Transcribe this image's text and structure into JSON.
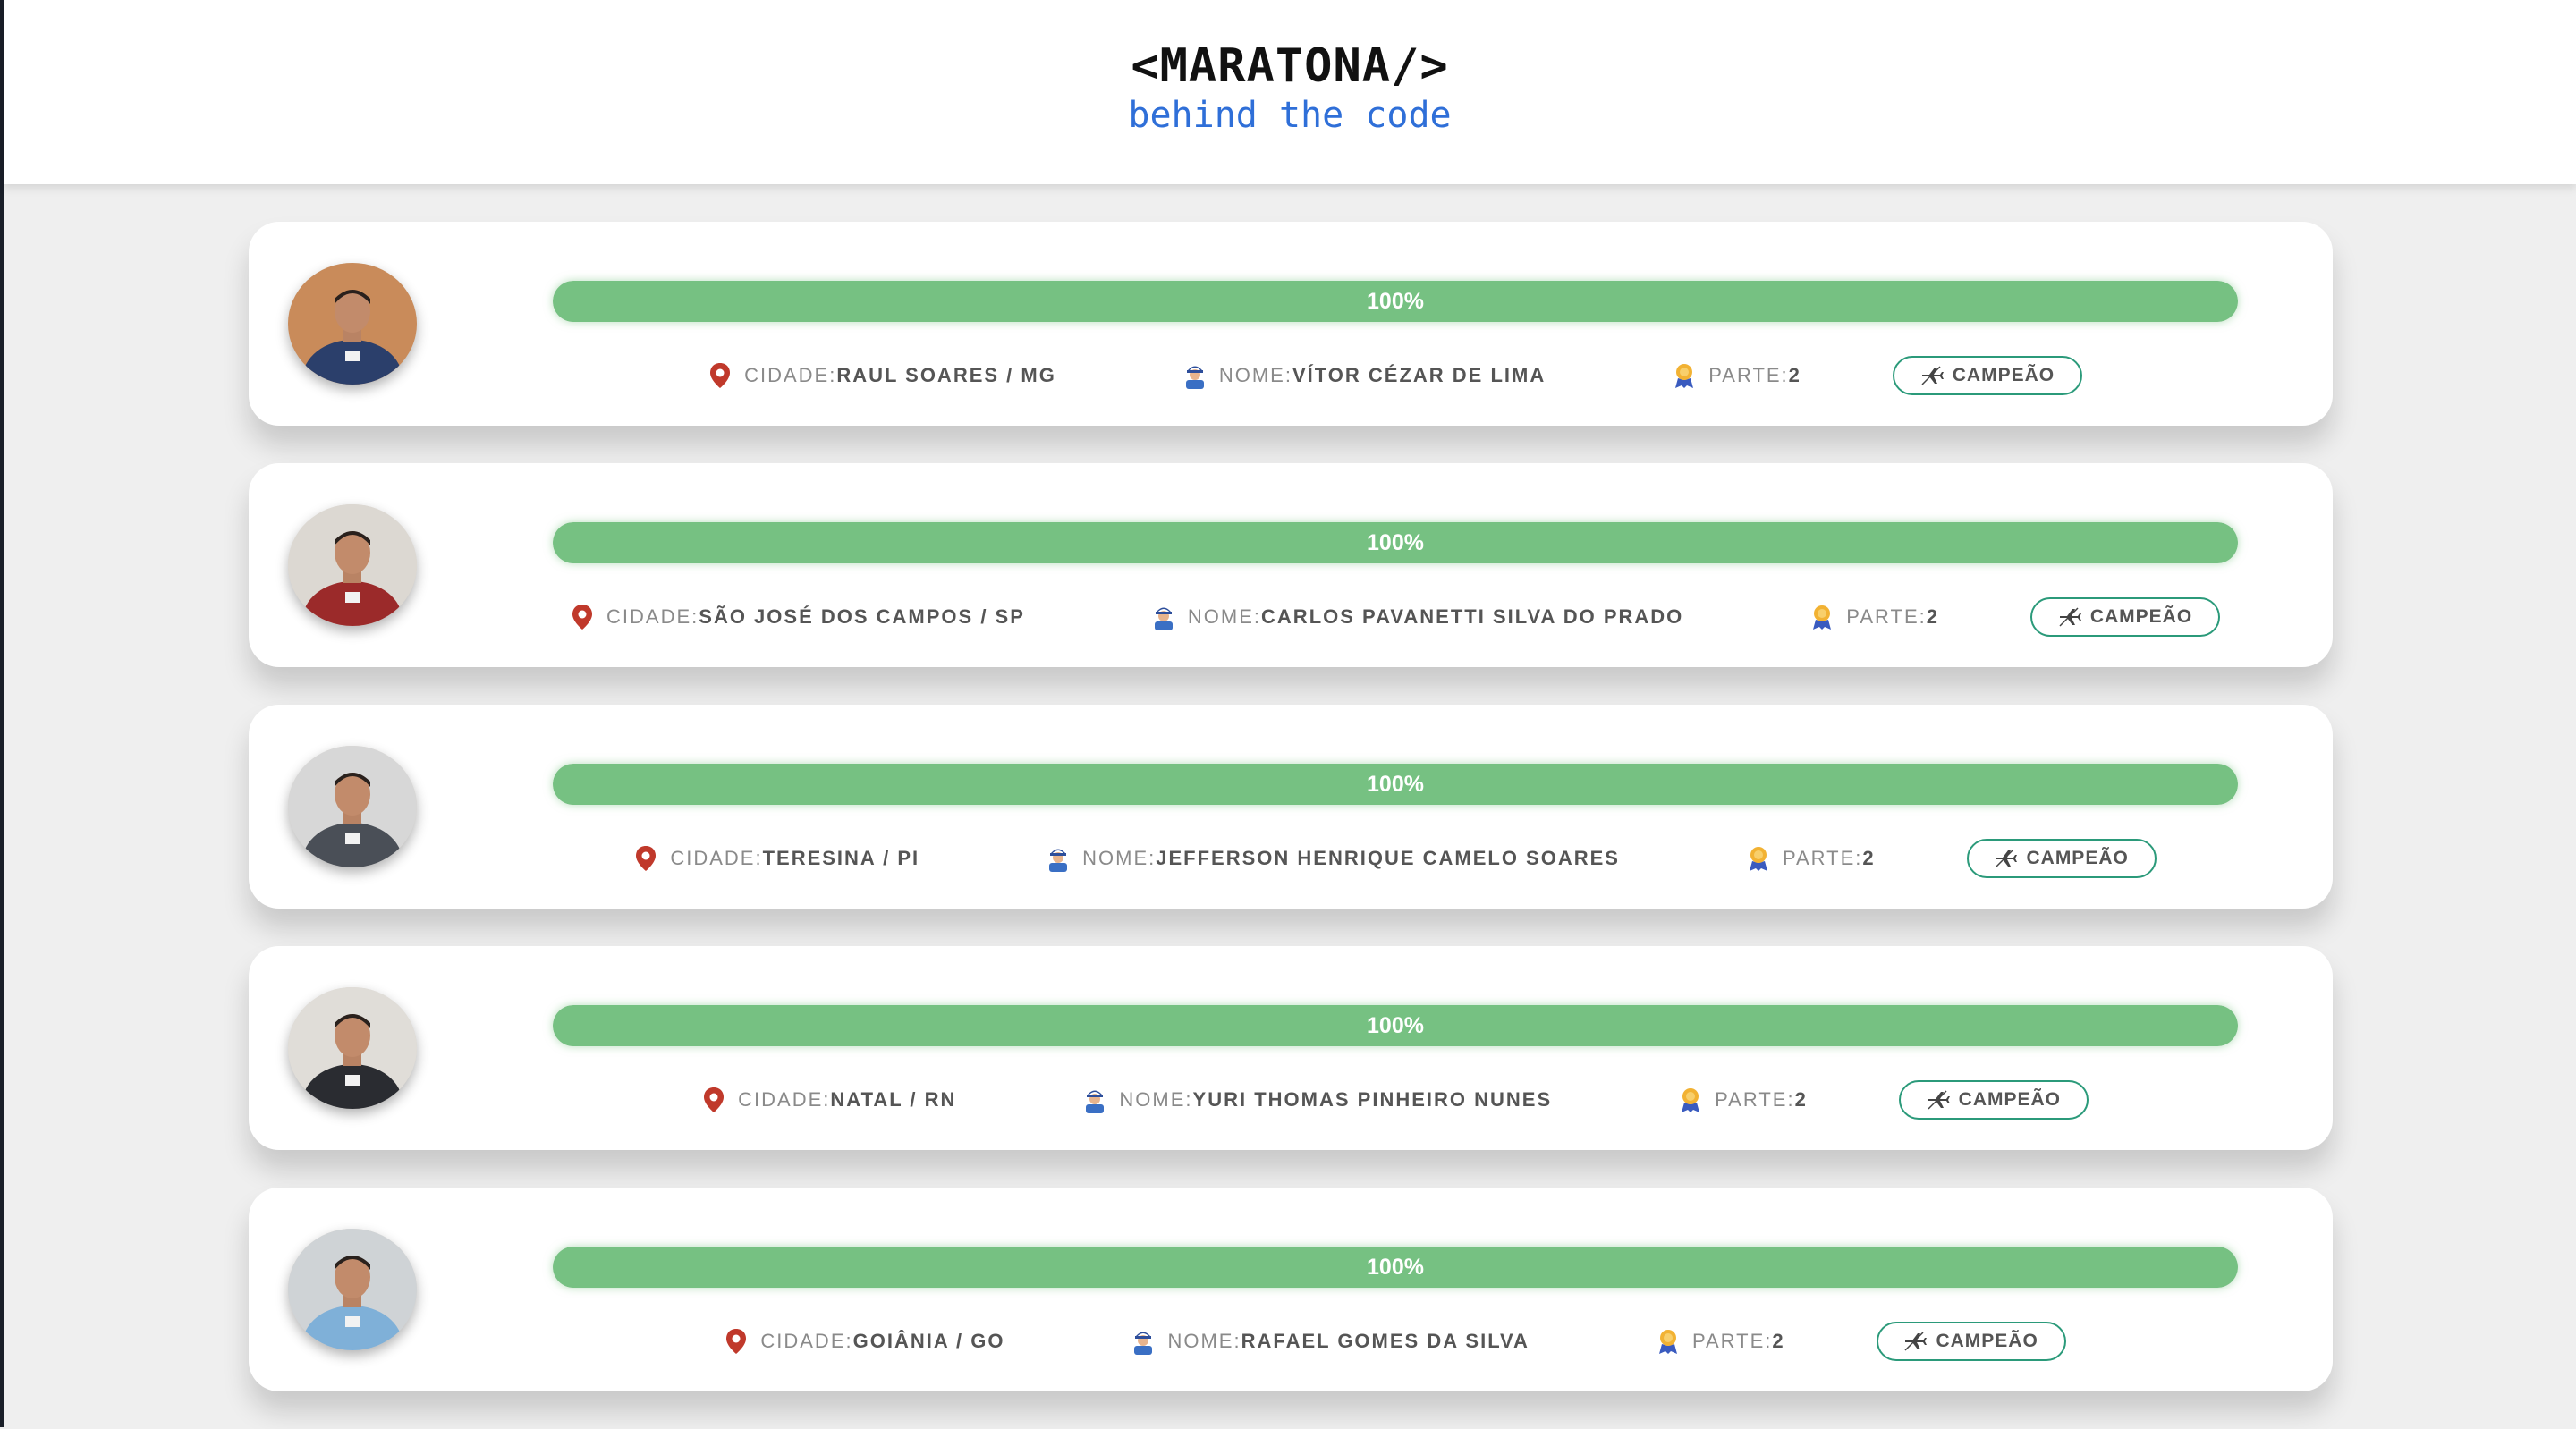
{
  "header": {
    "title": "<MARATONA/>",
    "subtitle": "behind the code"
  },
  "labels": {
    "city": "CIDADE:",
    "name": "NOME:",
    "part": "PARTE:",
    "champion": "CAMPEÃO"
  },
  "colors": {
    "progress": "#76c182",
    "accent_blue": "#2f6fd8",
    "champion_border": "#2b9a7a",
    "pin": "#c0392b"
  },
  "participants": [
    {
      "progress_percent": 100,
      "progress_label": "100%",
      "city": "RAUL SOARES / MG",
      "name": "VÍTOR CÉZAR DE LIMA",
      "part": "2",
      "shirt": "#2b3f6b",
      "bg": "#c98b5a"
    },
    {
      "progress_percent": 100,
      "progress_label": "100%",
      "city": "SÃO JOSÉ DOS CAMPOS / SP",
      "name": "CARLOS PAVANETTI SILVA DO PRADO",
      "part": "2",
      "shirt": "#9b2a2a",
      "bg": "#dcd8d2"
    },
    {
      "progress_percent": 100,
      "progress_label": "100%",
      "city": "TERESINA / PI",
      "name": "JEFFERSON HENRIQUE CAMELO SOARES",
      "part": "2",
      "shirt": "#4a4f57",
      "bg": "#d7d7d7"
    },
    {
      "progress_percent": 100,
      "progress_label": "100%",
      "city": "NATAL / RN",
      "name": "YURI THOMAS PINHEIRO NUNES",
      "part": "2",
      "shirt": "#2a2c31",
      "bg": "#e0ddd8"
    },
    {
      "progress_percent": 100,
      "progress_label": "100%",
      "city": "GOIÂNIA / GO",
      "name": "RAFAEL GOMES DA SILVA",
      "part": "2",
      "shirt": "#7fb0d8",
      "bg": "#cfd3d6"
    }
  ]
}
